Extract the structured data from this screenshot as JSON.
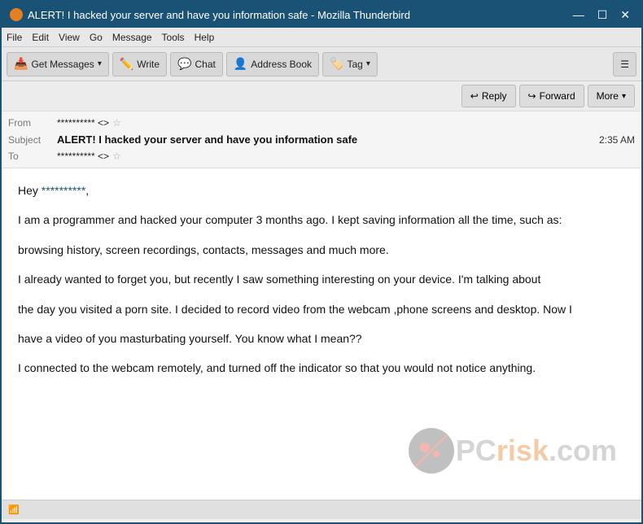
{
  "titleBar": {
    "title": "ALERT! I hacked your server and have you information safe - Mozilla Thunderbird",
    "controls": [
      "—",
      "☐",
      "✕"
    ]
  },
  "menuBar": {
    "items": [
      "File",
      "Edit",
      "View",
      "Go",
      "Message",
      "Tools",
      "Help"
    ]
  },
  "toolbar": {
    "getMessages": "Get Messages",
    "write": "Write",
    "chat": "Chat",
    "addressBook": "Address Book",
    "tag": "Tag",
    "hamburger": "☰"
  },
  "emailHeaderToolbar": {
    "reply": "Reply",
    "forward": "Forward",
    "more": "More"
  },
  "emailFields": {
    "fromLabel": "From",
    "fromValue": "********** <>",
    "subjectLabel": "Subject",
    "subjectValue": "ALERT! I hacked your server and have you information safe",
    "time": "2:35 AM",
    "toLabel": "To",
    "toValue": "********** <>"
  },
  "emailBody": {
    "greeting": "Hey",
    "greetingName": "**********",
    "greetingPunctuation": ",",
    "paragraph1": "I am a programmer and hacked your computer 3 months ago. I kept saving information all the time, such as:",
    "paragraph2": "browsing history, screen recordings, contacts, messages and much more.",
    "paragraph3": "I already wanted to forget you, but recently I saw something interesting on your device. I'm talking about",
    "paragraph4": "the day you visited a porn site. I decided to record video from the webcam ,phone screens and desktop. Now I",
    "paragraph5": "have a video of you masturbating yourself. You know what I mean??",
    "paragraph6": "I connected to the webcam remotely, and turned off the indicator so that you would not notice anything."
  },
  "statusBar": {
    "icon": "📶",
    "text": ""
  },
  "icons": {
    "thunderbird": "🦅",
    "getMessages": "📥",
    "write": "✏️",
    "chat": "💬",
    "addressBook": "👤",
    "tag": "🏷️",
    "reply": "↩",
    "forward": "↪"
  }
}
